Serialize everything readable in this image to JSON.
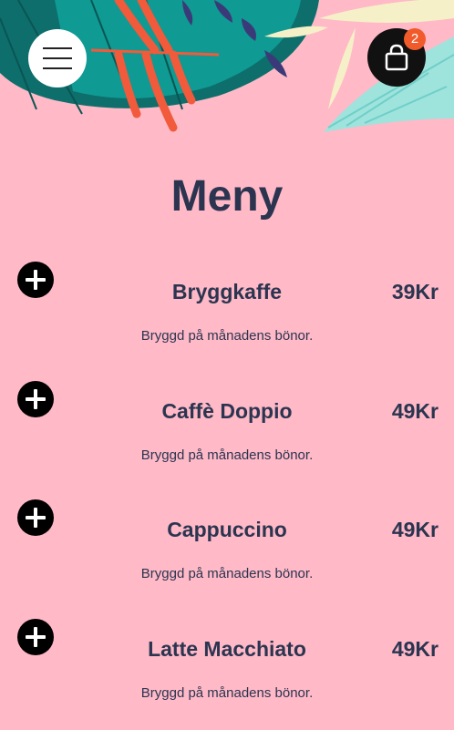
{
  "header": {
    "menu_icon": "hamburger-icon",
    "cart_icon": "shopping-bag-icon",
    "cart_count": "2"
  },
  "page": {
    "title": "Meny"
  },
  "colors": {
    "background": "#ffb9c7",
    "text": "#2b3550",
    "badge": "#f15a2b",
    "leaf_teal": "#0f9a93",
    "leaf_orange": "#f15a3a",
    "leaf_navy": "#3b3a78",
    "leaf_cream": "#f6f0c8",
    "leaf_mint": "#9fe3dd"
  },
  "menu": {
    "add_icon": "plus-circle-icon",
    "items": [
      {
        "name": "Bryggkaffe",
        "price": "39Kr",
        "description": "Bryggd på månadens bönor."
      },
      {
        "name": "Caffè Doppio",
        "price": "49Kr",
        "description": "Bryggd på månadens bönor."
      },
      {
        "name": "Cappuccino",
        "price": "49Kr",
        "description": "Bryggd på månadens bönor."
      },
      {
        "name": "Latte Macchiato",
        "price": "49Kr",
        "description": "Bryggd på månadens bönor."
      }
    ]
  }
}
